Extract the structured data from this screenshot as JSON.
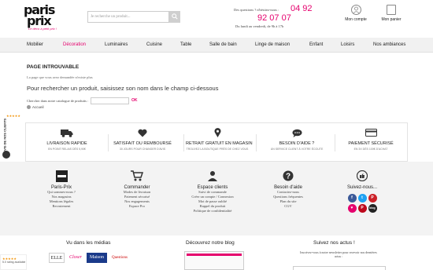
{
  "header": {
    "logo_line1": "paris",
    "logo_line2": "prix",
    "logo_tagline": "Le déco à petit prix !",
    "search_placeholder": "Je recherche un produit...",
    "contact_question": "Des questions ? n'hésitez-nous :",
    "phone_part1": "04 92",
    "phone_part2": "92 07 07",
    "hours": "Du lundi au vendredi, de 9h à 17h",
    "account_label": "Mon compte",
    "cart_label": "Mon panier"
  },
  "nav": {
    "items": [
      "Mobilier",
      "Décoration",
      "Luminaires",
      "Cuisine",
      "Table",
      "Salle de bain",
      "Linge de maison",
      "Enfant",
      "Loisirs",
      "Nos ambiances"
    ]
  },
  "main": {
    "title": "PAGE INTROUVABLE",
    "subtitle": "La page que vous avez demandée n'existe plus",
    "lead": "Pour rechercher un produit, saisissez son nom dans le champ ci-dessous",
    "form_label": "Chercher dans notre catalogue de produits :",
    "form_ok": "OK",
    "home_link": "Accueil"
  },
  "reviews_badge": {
    "vertical_text": "AVIS DE NOS CLIENTS",
    "stars": "★★★★★"
  },
  "features": [
    {
      "title": "LIVRAISON RAPIDE",
      "sub": "EN POINT RELAIS DÈS 5,90€",
      "icon": "truck-icon"
    },
    {
      "title": "SATISFAIT OU REMBOURSÉ",
      "sub": "30 JOURS POUR CHANGER D'AVIS",
      "icon": "heart-icon"
    },
    {
      "title": "RETRAIT GRATUIT EN MAGASIN",
      "sub": "TROUVEZ LA BOUTIQUE PRÈS DE CHEZ VOUS",
      "icon": "map-pin-icon"
    },
    {
      "title": "BESOIN D'AIDE ?",
      "sub": "UN SERVICE CLIENT À VOTRE ÉCOUTE",
      "icon": "chat-icon"
    },
    {
      "title": "PAIEMENT SÉCURISÉ",
      "sub": "EN 3X DÈS 100€ D'ACHAT",
      "icon": "credit-card-icon"
    }
  ],
  "footer": {
    "columns": [
      {
        "heading": "Paris-Prix",
        "links": [
          "Qui sommes-nous ?",
          "Nos magasins",
          "Mentions légales",
          "Recrutement"
        ]
      },
      {
        "heading": "Commander",
        "links": [
          "Modes de livraison",
          "Paiement sécurisé",
          "Nos engagements",
          "Espace Pro"
        ]
      },
      {
        "heading": "Espace clients",
        "links": [
          "Suivi de commande",
          "Créer un compte / Connexion",
          "Mot de passe oublié",
          "Rappel du produit",
          "Politique de confidentialité"
        ]
      },
      {
        "heading": "Besoin d'aide",
        "links": [
          "Contactez-nous",
          "Questions fréquentes",
          "Plan du site",
          "CGV"
        ]
      },
      {
        "heading": "Suivez-nous...",
        "links": []
      }
    ],
    "social_labels": [
      "f",
      "t",
      "P",
      "♥",
      "P",
      "blog"
    ],
    "social_colors": [
      "#3b5998",
      "#1da1f2",
      "#cb2027",
      "#e5006d",
      "#bd081c",
      "#222222"
    ]
  },
  "bottom": {
    "media_heading": "Vu dans les médias",
    "press": [
      "ELLE",
      "Closer",
      "Maison",
      "Questions"
    ],
    "blog_heading": "Découvrez notre blog",
    "newsletter_heading": "Suivez nos actus !",
    "newsletter_text": "Inscrivez-vous à notre newsletter pour recevoir nos dernières actus :",
    "rating_label": "5.0 rating available"
  },
  "colors": {
    "accent": "#e5006d",
    "nav_bg": "#f1f1f1",
    "footer_bg": "#f3f3f3"
  }
}
